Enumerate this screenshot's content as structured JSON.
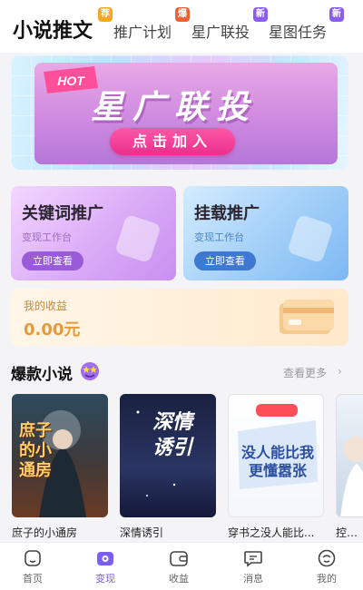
{
  "top_tabs": [
    {
      "label": "小说推文",
      "badge": "荐",
      "badge_color": "#f5a623",
      "active": true
    },
    {
      "label": "推广计划",
      "badge": "爆",
      "badge_color": "#f06034"
    },
    {
      "label": "星广联投",
      "badge": "新",
      "badge_color": "#8a5cf5"
    },
    {
      "label": "星图任务",
      "badge": "新",
      "badge_color": "#8a5cf5"
    }
  ],
  "banner": {
    "hot_label": "HOT",
    "title": "星广联投",
    "button": "点击加入"
  },
  "cards": [
    {
      "title": "关键词推广",
      "subtitle": "变现工作台",
      "button": "立即查看"
    },
    {
      "title": "挂载推广",
      "subtitle": "变现工作台",
      "button": "立即查看"
    }
  ],
  "earnings": {
    "label": "我的收益",
    "value": "0.00元"
  },
  "section": {
    "title": "爆款小说",
    "more": "查看更多",
    "more_arrow": "›"
  },
  "books": [
    {
      "title": "庶子的小通房",
      "cover_text": "庶子的小通房"
    },
    {
      "title": "深情诱引",
      "cover_text": "深情诱引"
    },
    {
      "title": "穿书之没人能比...",
      "cover_text": "没人能比我更懂嚣张"
    },
    {
      "title": "控分的",
      "cover_text": ""
    }
  ],
  "bottom_nav": [
    {
      "label": "首页",
      "icon": "home-icon"
    },
    {
      "label": "变现",
      "icon": "monetize-icon",
      "active": true
    },
    {
      "label": "收益",
      "icon": "wallet-icon"
    },
    {
      "label": "消息",
      "icon": "message-icon"
    },
    {
      "label": "我的",
      "icon": "profile-icon"
    }
  ],
  "colors": {
    "accent": "#7b5ef5",
    "banner_button": "#ea2f8c",
    "earnings_value": "#e79a3a"
  }
}
